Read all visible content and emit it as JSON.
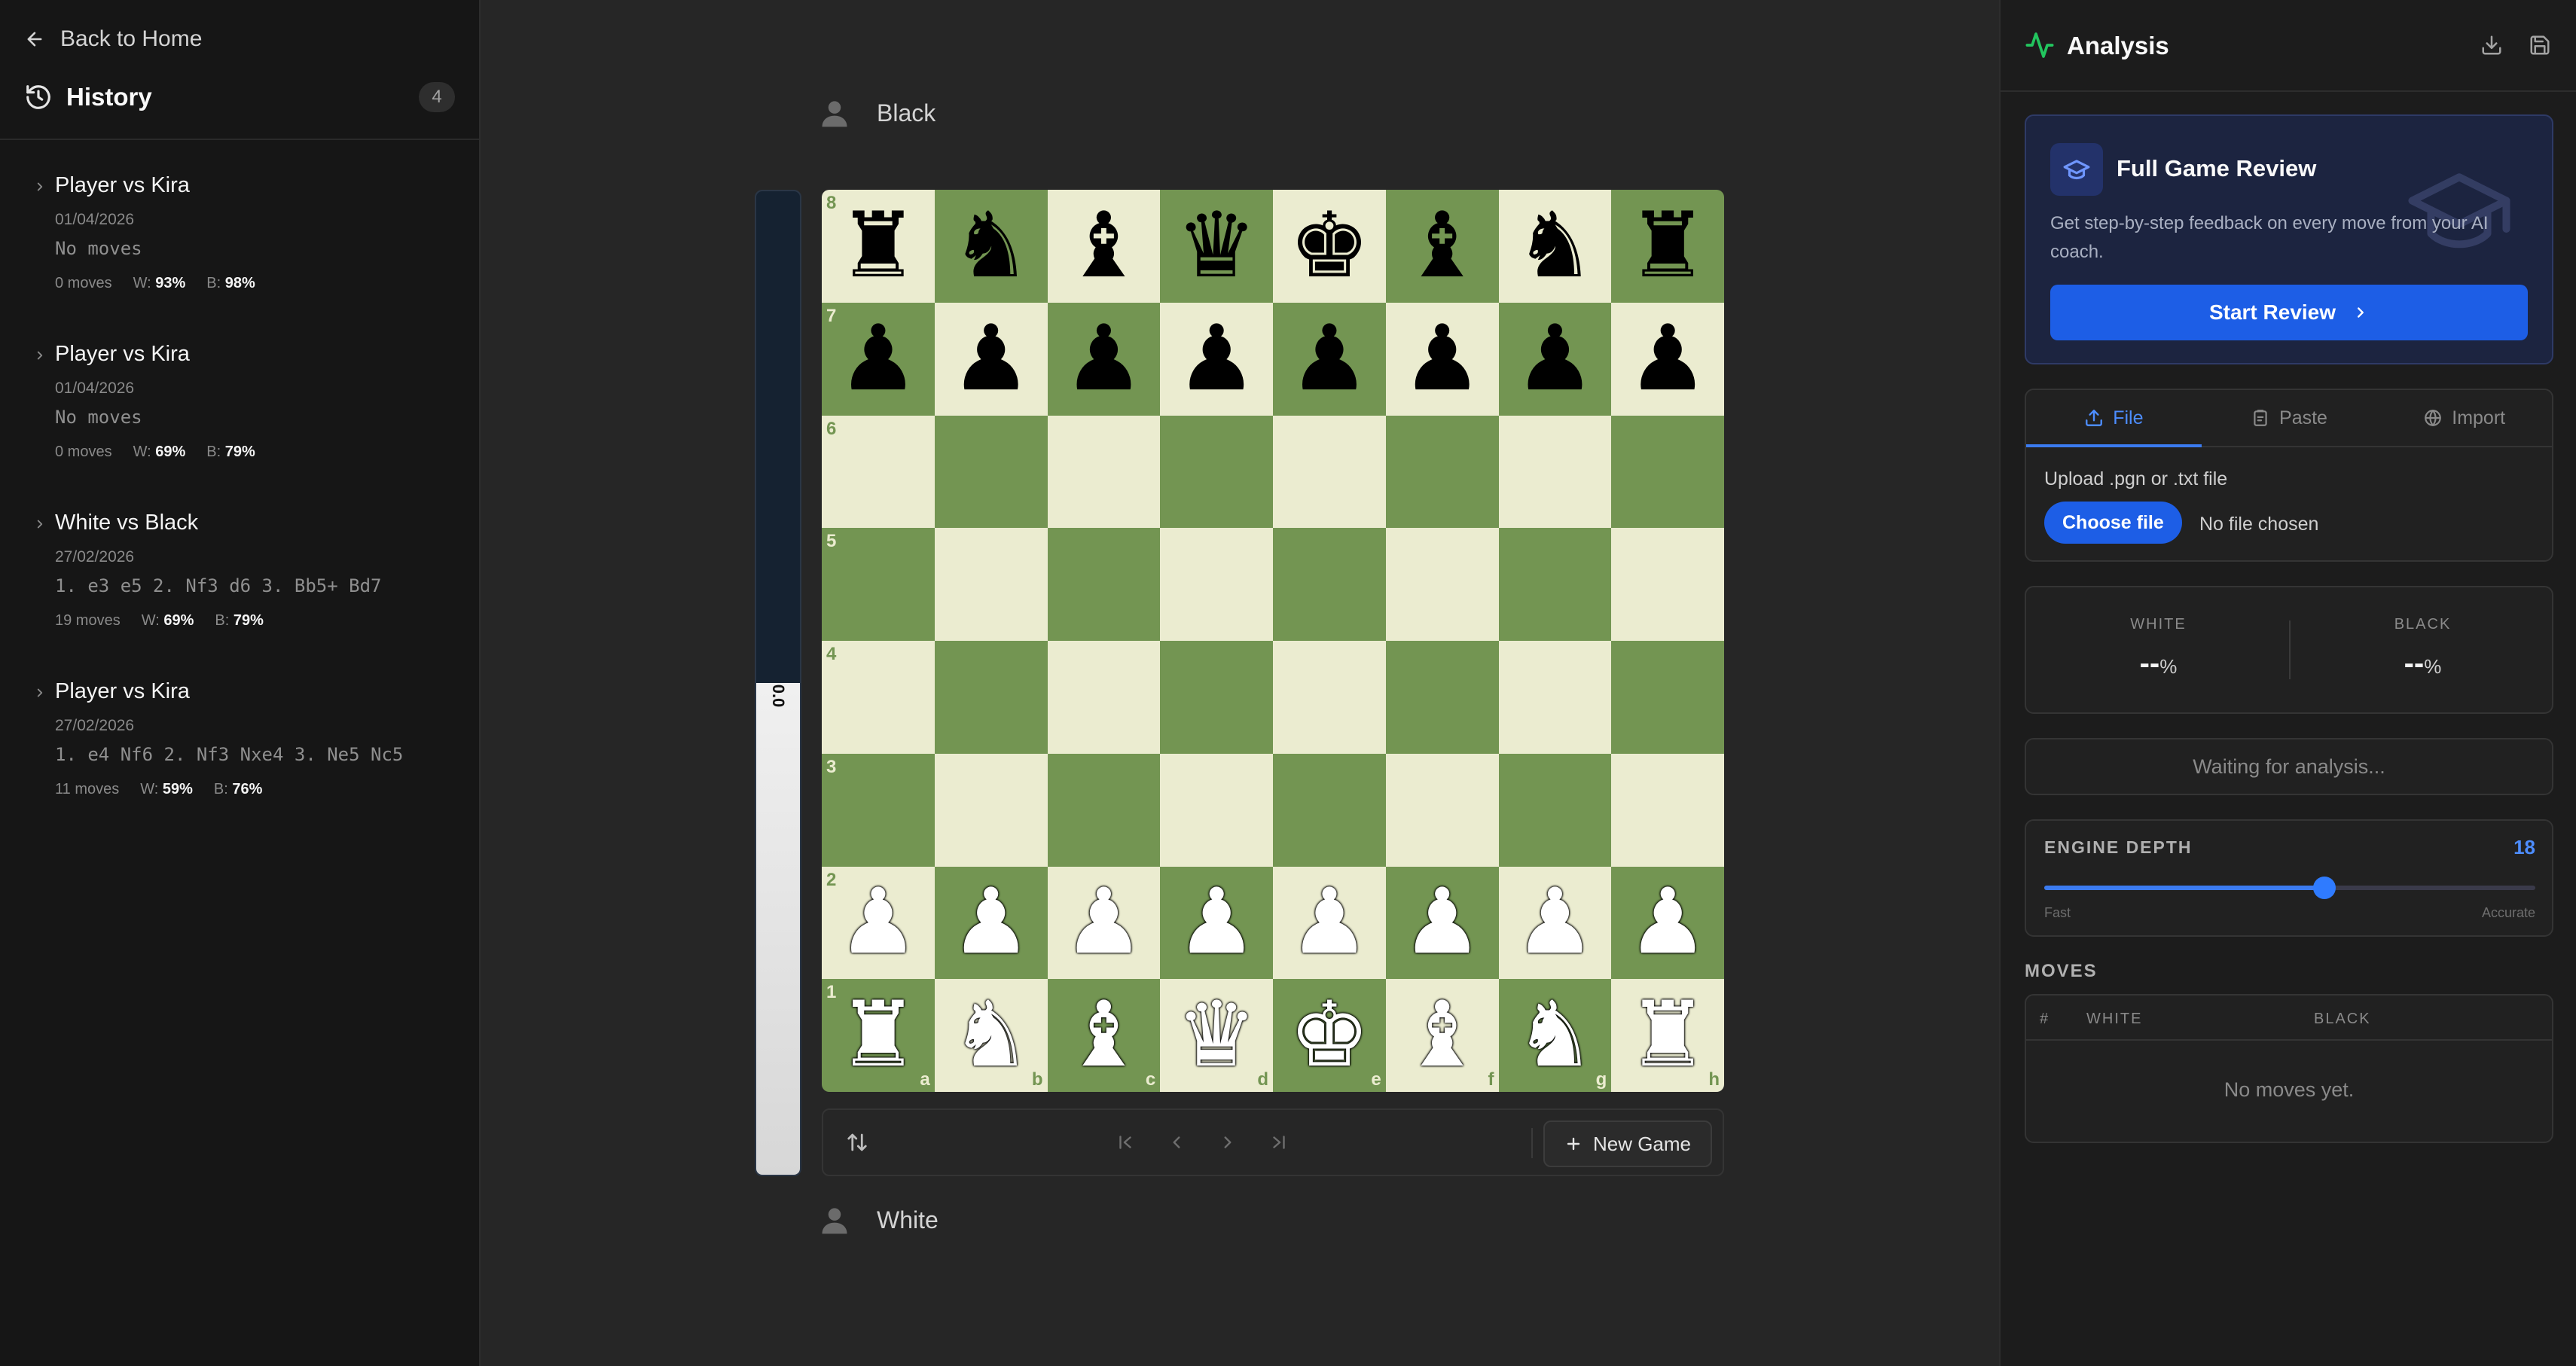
{
  "sidebar": {
    "back_label": "Back to Home",
    "history_title": "History",
    "history_count": "4",
    "games": [
      {
        "title": "Player vs Kira",
        "date": "01/04/2026",
        "moves": "No moves",
        "move_count": "0 moves",
        "w_label": "W:",
        "w_value": "93%",
        "b_label": "B:",
        "b_value": "98%"
      },
      {
        "title": "Player vs Kira",
        "date": "01/04/2026",
        "moves": "No moves",
        "move_count": "0 moves",
        "w_label": "W:",
        "w_value": "69%",
        "b_label": "B:",
        "b_value": "79%"
      },
      {
        "title": "White vs Black",
        "date": "27/02/2026",
        "moves": "1. e3 e5 2. Nf3 d6 3. Bb5+ Bd7",
        "move_count": "19 moves",
        "w_label": "W:",
        "w_value": "69%",
        "b_label": "B:",
        "b_value": "79%"
      },
      {
        "title": "Player vs Kira",
        "date": "27/02/2026",
        "moves": "1. e4 Nf6 2. Nf3 Nxe4 3. Ne5 Nc5",
        "move_count": "11 moves",
        "w_label": "W:",
        "w_value": "59%",
        "b_label": "B:",
        "b_value": "76%"
      }
    ]
  },
  "board": {
    "top_player": "Black",
    "bottom_player": "White",
    "eval_label": "0.0",
    "eval_white_fraction": 0.5,
    "ranks": [
      "8",
      "7",
      "6",
      "5",
      "4",
      "3",
      "2",
      "1"
    ],
    "files": [
      "a",
      "b",
      "c",
      "d",
      "e",
      "f",
      "g",
      "h"
    ],
    "position": [
      "rnbqkbnr",
      "pppppppp",
      "........",
      "........",
      "........",
      "........",
      "PPPPPPPP",
      "RNBQKBNR"
    ],
    "light_color": "#ebecd0",
    "dark_color": "#739552"
  },
  "controls": {
    "flip_icon": "flip-board-icon",
    "first_icon": "skip-to-start-icon",
    "prev_icon": "step-back-icon",
    "next_icon": "step-forward-icon",
    "last_icon": "skip-to-end-icon",
    "new_game_label": "New Game"
  },
  "analysis": {
    "title": "Analysis",
    "download_icon": "download-icon",
    "save_icon": "save-icon",
    "review": {
      "title": "Full Game Review",
      "text": "Get step-by-step feedback on every move from your AI coach.",
      "button": "Start Review"
    },
    "tabs": [
      {
        "label": "File",
        "icon": "upload-icon",
        "active": true
      },
      {
        "label": "Paste",
        "icon": "clipboard-icon",
        "active": false
      },
      {
        "label": "Import",
        "icon": "globe-icon",
        "active": false
      }
    ],
    "upload_label": "Upload .pgn or .txt file",
    "choose_button": "Choose file",
    "no_file": "No file chosen",
    "white_label": "WHITE",
    "white_value": "--",
    "black_label": "BLACK",
    "black_value": "--",
    "percent": "%",
    "waiting": "Waiting for analysis...",
    "depth_label": "ENGINE DEPTH",
    "depth_value": "18",
    "depth_fraction": 0.57,
    "depth_fast": "Fast",
    "depth_accurate": "Accurate",
    "moves_label": "MOVES",
    "moves_cols": [
      "#",
      "WHITE",
      "BLACK"
    ],
    "moves_empty": "No moves yet."
  },
  "colors": {
    "accent": "#1d5ee6",
    "accent_text": "#4d8dff",
    "activity_icon": "#22c55e"
  }
}
